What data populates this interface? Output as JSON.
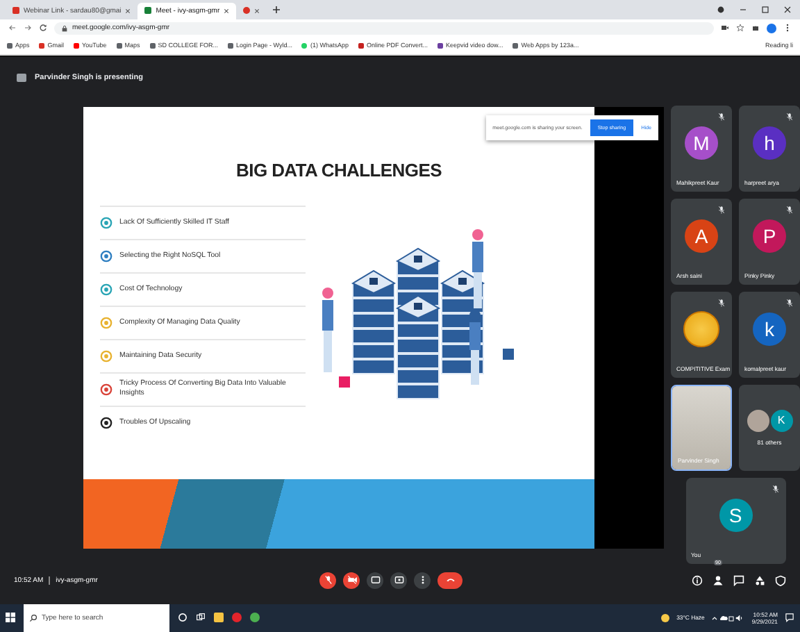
{
  "browser": {
    "tabs": [
      {
        "title": "Webinar Link - sardau80@gmai",
        "selected": false
      },
      {
        "title": "Meet - ivy-asgm-gmr",
        "selected": true
      },
      {
        "selected": false
      }
    ],
    "url": "meet.google.com/ivy-asgm-gmr",
    "bookmarks": [
      "Apps",
      "Gmail",
      "YouTube",
      "Maps",
      "SD COLLEGE FOR...",
      "Login Page - Wyld...",
      "(1) WhatsApp",
      "Online PDF Convert...",
      "Keepvid video dow...",
      "Web Apps by 123a..."
    ],
    "reading_list": "Reading li"
  },
  "banner": "Parvinder Singh is presenting",
  "share_bar": {
    "message": "meet.google.com is sharing your screen.",
    "stop": "Stop sharing",
    "hide": "Hide"
  },
  "slide": {
    "title": "BIG DATA CHALLENGES",
    "items": [
      {
        "text": "Lack Of Sufficiently Skilled IT Staff",
        "color": "#2aa5b5"
      },
      {
        "text": "Selecting the Right NoSQL Tool",
        "color": "#2f7fc1"
      },
      {
        "text": "Cost Of Technology",
        "color": "#2aa5b5"
      },
      {
        "text": "Complexity Of Managing Data Quality",
        "color": "#e8b230"
      },
      {
        "text": "Maintaining Data Security",
        "color": "#e8b230"
      },
      {
        "text": "Tricky Process Of Converting Big Data Into Valuable Insights",
        "color": "#d9443a"
      },
      {
        "text": "Troubles Of Upscaling",
        "color": "#222222"
      }
    ]
  },
  "participants": [
    {
      "kind": "avatar",
      "letter": "M",
      "name": "Mahikpreet Kaur",
      "color": "#a64fc9",
      "muted": true
    },
    {
      "kind": "avatar",
      "letter": "h",
      "name": "harpreet arya",
      "color": "#5a2fc2",
      "muted": true
    },
    {
      "kind": "avatar",
      "letter": "A",
      "name": "Arsh saini",
      "color": "#d84315",
      "muted": true
    },
    {
      "kind": "avatar",
      "letter": "P",
      "name": "Pinky Pinky",
      "color": "#c2185b",
      "muted": true
    },
    {
      "kind": "image",
      "name": "COMPITITIVE Exam",
      "muted": true
    },
    {
      "kind": "avatar",
      "letter": "k",
      "name": "komalpreet kaur",
      "color": "#1565c0",
      "muted": true
    },
    {
      "kind": "video",
      "name": "Parvinder Singh",
      "muted": false
    },
    {
      "kind": "others",
      "letter": "K",
      "name": "81 others",
      "color": "#0097a7",
      "muted": false
    },
    {
      "kind": "avatar",
      "letter": "S",
      "name": "You",
      "color": "#0097a7",
      "muted": true
    }
  ],
  "meeting": {
    "time": "10:52 AM",
    "code": "ivy-asgm-gmr",
    "people_count": "90"
  },
  "taskbar": {
    "search_placeholder": "Type here to search",
    "weather": "33°C Haze",
    "time": "10:52 AM",
    "date": "9/29/2021"
  }
}
